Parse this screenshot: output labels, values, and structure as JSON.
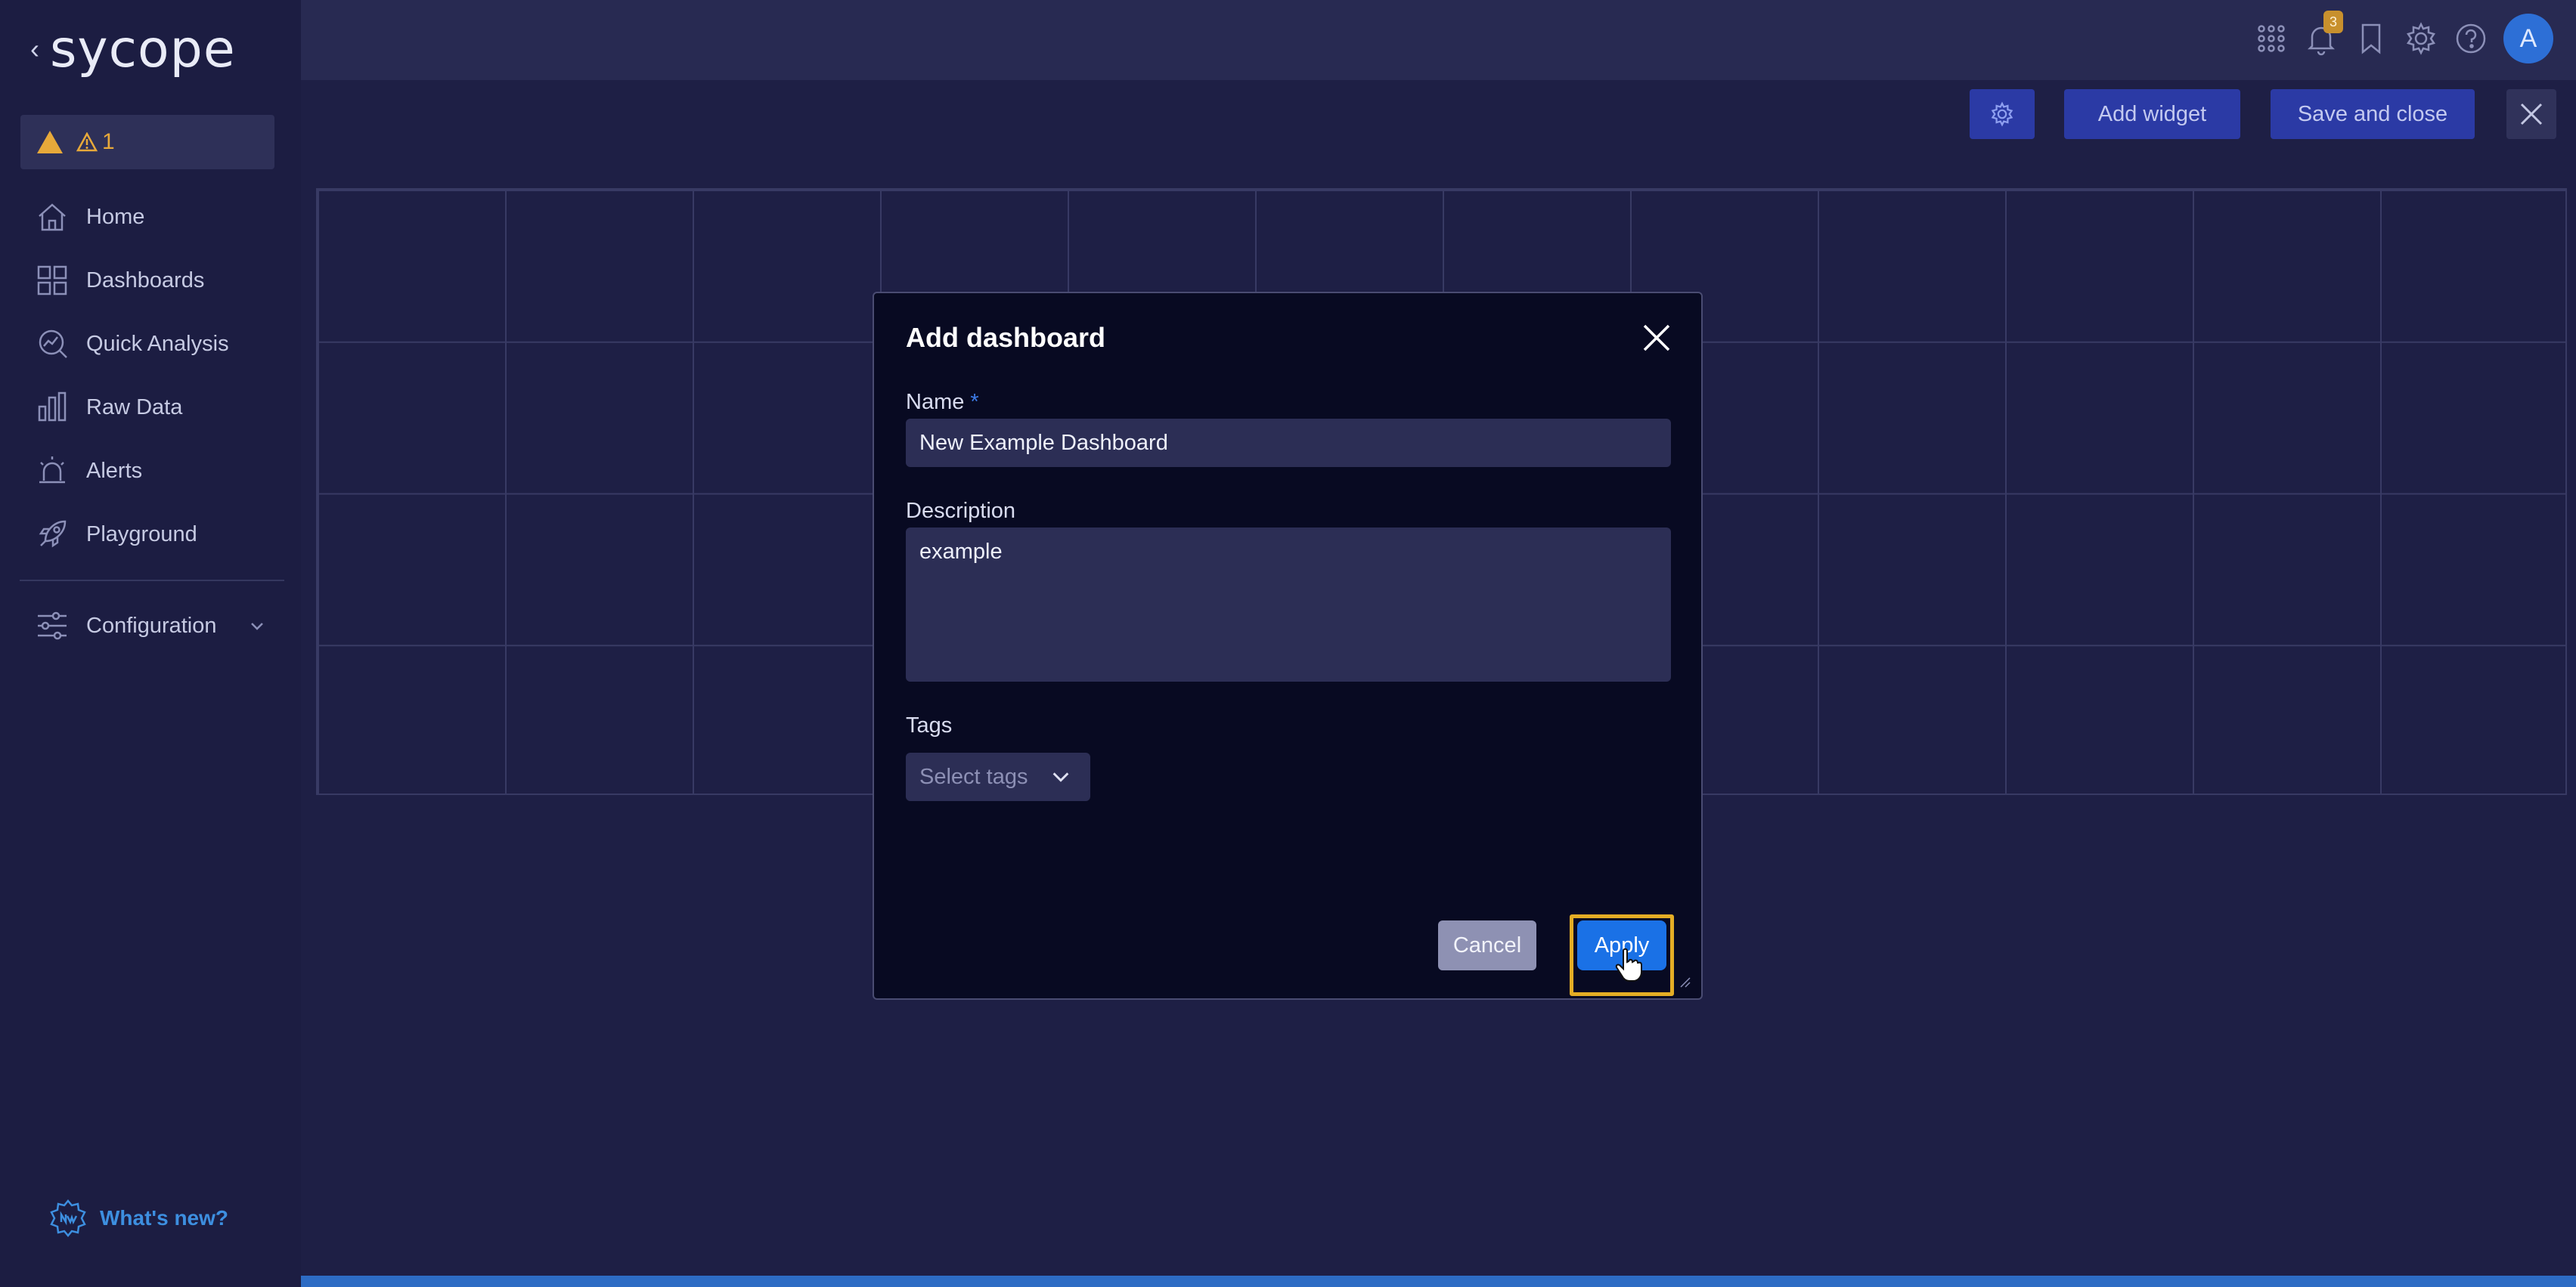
{
  "brand": {
    "name": "sycope",
    "back_icon": "chevron-left-icon"
  },
  "alert_indicator": {
    "count": "1",
    "icon": "warning-triangle-icon",
    "color": "#e7a93a"
  },
  "sidebar": {
    "items": [
      {
        "label": "Home",
        "icon": "home-icon"
      },
      {
        "label": "Dashboards",
        "icon": "grid-icon"
      },
      {
        "label": "Quick Analysis",
        "icon": "analysis-icon"
      },
      {
        "label": "Raw Data",
        "icon": "bar-chart-icon"
      },
      {
        "label": "Alerts",
        "icon": "alarm-icon"
      },
      {
        "label": "Playground",
        "icon": "rocket-icon"
      }
    ],
    "configuration": {
      "label": "Configuration",
      "icon": "sliders-icon"
    },
    "whats_new": {
      "label": "What's new?",
      "icon": "new-badge-icon"
    }
  },
  "topbar": {
    "notification_count": "3",
    "avatar_letter": "A"
  },
  "toolbar": {
    "add_widget_label": "Add widget",
    "save_close_label": "Save and close"
  },
  "modal": {
    "title": "Add dashboard",
    "name_label": "Name",
    "name_required_mark": "*",
    "name_value": "New Example Dashboard",
    "description_label": "Description",
    "description_value": "example",
    "tags_label": "Tags",
    "tags_placeholder": "Select tags",
    "cancel_label": "Cancel",
    "apply_label": "Apply"
  },
  "colors": {
    "background": "#1e1f45",
    "sidebar": "#1c1d42",
    "modal": "#080a22",
    "primary": "#1a71e6",
    "toolbar_button": "#2b3aa5",
    "focus_ring": "#e4ad25"
  }
}
